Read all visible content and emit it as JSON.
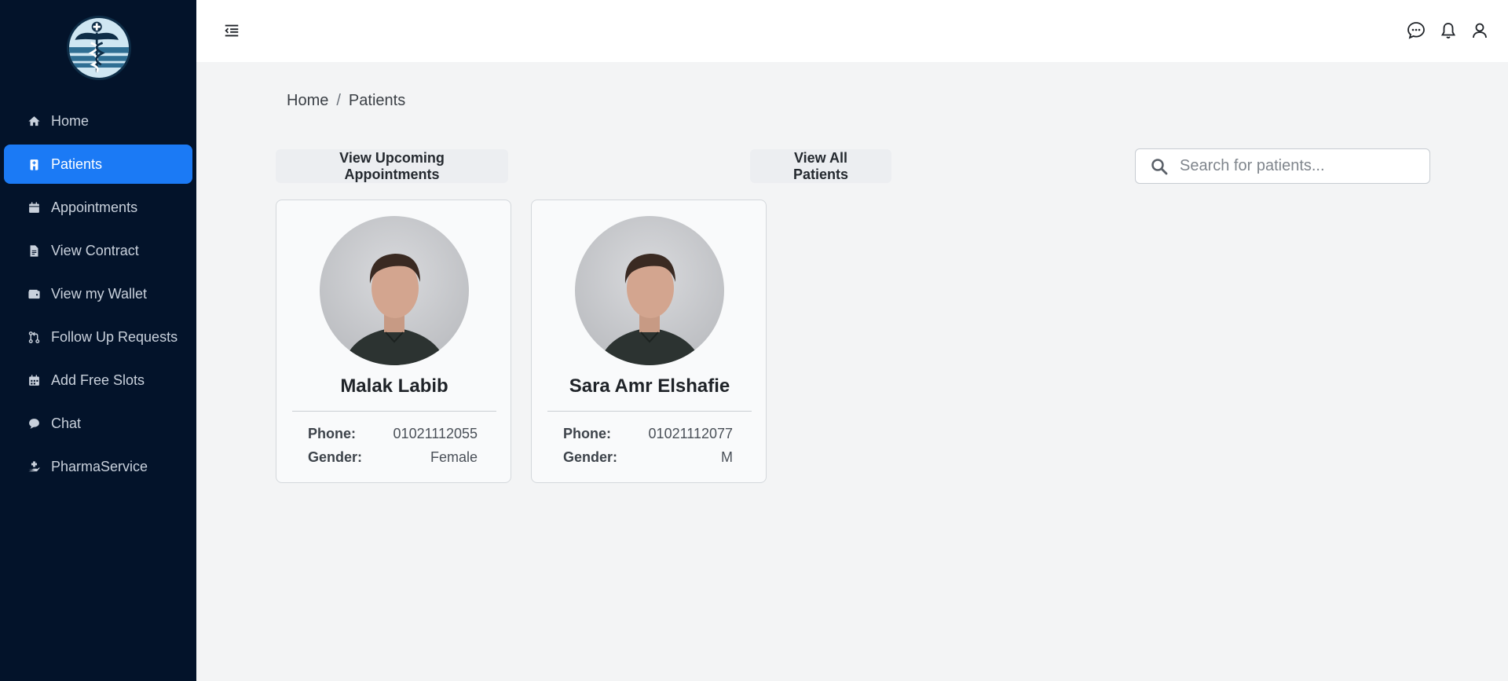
{
  "sidebar": {
    "items": [
      {
        "label": "Home",
        "icon": "home-icon"
      },
      {
        "label": "Patients",
        "icon": "hospital-user-icon",
        "active": true
      },
      {
        "label": "Appointments",
        "icon": "calendar-icon"
      },
      {
        "label": "View Contract",
        "icon": "document-icon"
      },
      {
        "label": "View my Wallet",
        "icon": "wallet-icon"
      },
      {
        "label": "Follow Up Requests",
        "icon": "git-pull-request-icon"
      },
      {
        "label": "Add Free Slots",
        "icon": "calendar-grid-icon"
      },
      {
        "label": "Chat",
        "icon": "chat-bubble-icon"
      },
      {
        "label": "PharmaService",
        "icon": "hand-holding-medical-icon"
      }
    ]
  },
  "breadcrumb": {
    "home": "Home",
    "separator": "/",
    "current": "Patients"
  },
  "actions": {
    "upcoming_label": "View Upcoming Appointments",
    "all_patients_label": "View All Patients"
  },
  "search": {
    "placeholder": "Search for patients..."
  },
  "patients": [
    {
      "name": "Malak Labib",
      "phone_label": "Phone:",
      "phone": "01021112055",
      "gender_label": "Gender:",
      "gender": "Female"
    },
    {
      "name": "Sara Amr Elshafie",
      "phone_label": "Phone:",
      "phone": "01021112077",
      "gender_label": "Gender:",
      "gender": "M"
    }
  ],
  "colors": {
    "sidebar_bg": "#03132a",
    "accent": "#1b7af5",
    "page_bg": "#f3f4f5"
  }
}
